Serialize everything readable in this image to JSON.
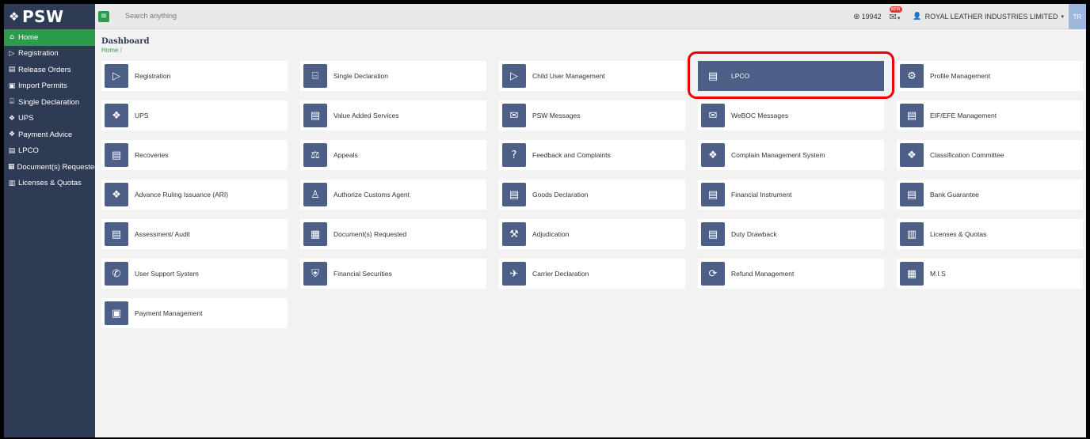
{
  "app": {
    "logo_mark": "❖",
    "logo_text": "PSW"
  },
  "sidebar": {
    "items": [
      {
        "label": "Home",
        "icon": "⌂",
        "icon_name": "home-icon",
        "active": true
      },
      {
        "label": "Registration",
        "icon": "▷",
        "icon_name": "registration-icon"
      },
      {
        "label": "Release Orders",
        "icon": "▤",
        "icon_name": "release-orders-icon"
      },
      {
        "label": "Import Permits",
        "icon": "▣",
        "icon_name": "import-permits-icon"
      },
      {
        "label": "Single Declaration",
        "icon": "⌸",
        "icon_name": "single-declaration-icon"
      },
      {
        "label": "UPS",
        "icon": "❖",
        "icon_name": "ups-icon"
      },
      {
        "label": "Payment Advice",
        "icon": "❖",
        "icon_name": "payment-advice-icon"
      },
      {
        "label": "LPCO",
        "icon": "▤",
        "icon_name": "lpco-icon"
      },
      {
        "label": "Document(s) Requested",
        "icon": "▦",
        "icon_name": "documents-requested-icon"
      },
      {
        "label": "Licenses & Quotas",
        "icon": "▥",
        "icon_name": "licenses-quotas-icon"
      }
    ]
  },
  "topbar": {
    "menu_icon": "≡",
    "search_placeholder": "Search anything",
    "points_icon": "⊛",
    "points": "19942",
    "notif_icon": "✉",
    "notif_badge": "NEW",
    "caret": "▾",
    "user_icon": "👤",
    "user_name": "ROYAL LEATHER INDUSTRIES LIMITED",
    "avatar_initials": "TR"
  },
  "page": {
    "title": "Dashboard",
    "breadcrumb_home": "Home",
    "breadcrumb_sep": " /"
  },
  "cards": [
    {
      "label": "Registration",
      "icon": "▷",
      "name": "registration"
    },
    {
      "label": "Single Declaration",
      "icon": "⌸",
      "name": "single-declaration"
    },
    {
      "label": "Child User Management",
      "icon": "▷",
      "name": "child-user-management"
    },
    {
      "label": "LPCO",
      "icon": "▤",
      "name": "lpco",
      "selected": true
    },
    {
      "label": "Profile Management",
      "icon": "⚙",
      "name": "profile-management"
    },
    {
      "label": "UPS",
      "icon": "❖",
      "name": "ups"
    },
    {
      "label": "Value Added Services",
      "icon": "▤",
      "name": "value-added-services"
    },
    {
      "label": "PSW Messages",
      "icon": "✉",
      "name": "psw-messages"
    },
    {
      "label": "WeBOC Messages",
      "icon": "✉",
      "name": "weboc-messages"
    },
    {
      "label": "EIF/EFE Management",
      "icon": "▤",
      "name": "eif-efe-management"
    },
    {
      "label": "Recoveries",
      "icon": "▤",
      "name": "recoveries"
    },
    {
      "label": "Appeals",
      "icon": "⚖",
      "name": "appeals"
    },
    {
      "label": "Feedback and Complaints",
      "icon": "?",
      "name": "feedback-and-complaints"
    },
    {
      "label": "Complain Management System",
      "icon": "❖",
      "name": "complain-management-system"
    },
    {
      "label": "Classification Committee",
      "icon": "❖",
      "name": "classification-committee"
    },
    {
      "label": "Advance Ruling Issuance (ARI)",
      "icon": "❖",
      "name": "advance-ruling-issuance"
    },
    {
      "label": "Authorize Customs Agent",
      "icon": "♙",
      "name": "authorize-customs-agent"
    },
    {
      "label": "Goods Declaration",
      "icon": "▤",
      "name": "goods-declaration"
    },
    {
      "label": "Financial Instrument",
      "icon": "▤",
      "name": "financial-instrument"
    },
    {
      "label": "Bank Guarantee",
      "icon": "▤",
      "name": "bank-guarantee"
    },
    {
      "label": "Assessment/ Audit",
      "icon": "▤",
      "name": "assessment-audit"
    },
    {
      "label": "Document(s) Requested",
      "icon": "▦",
      "name": "documents-requested"
    },
    {
      "label": "Adjudication",
      "icon": "⚒",
      "name": "adjudication"
    },
    {
      "label": "Duty Drawback",
      "icon": "▤",
      "name": "duty-drawback"
    },
    {
      "label": "Licenses & Quotas",
      "icon": "▥",
      "name": "licenses-quotas"
    },
    {
      "label": "User Support System",
      "icon": "✆",
      "name": "user-support-system"
    },
    {
      "label": "Financial Securities",
      "icon": "⛨",
      "name": "financial-securities"
    },
    {
      "label": "Carrier Declaration",
      "icon": "✈",
      "name": "carrier-declaration"
    },
    {
      "label": "Refund Management",
      "icon": "⟳",
      "name": "refund-management"
    },
    {
      "label": "M.I.S",
      "icon": "▦",
      "name": "mis"
    },
    {
      "label": "Payment Management",
      "icon": "▣",
      "name": "payment-management"
    }
  ],
  "colors": {
    "sidebar_bg": "#2e3b55",
    "accent_green": "#2b9c4b",
    "tile_blue": "#4d5f86",
    "highlight_red": "#e00000"
  }
}
